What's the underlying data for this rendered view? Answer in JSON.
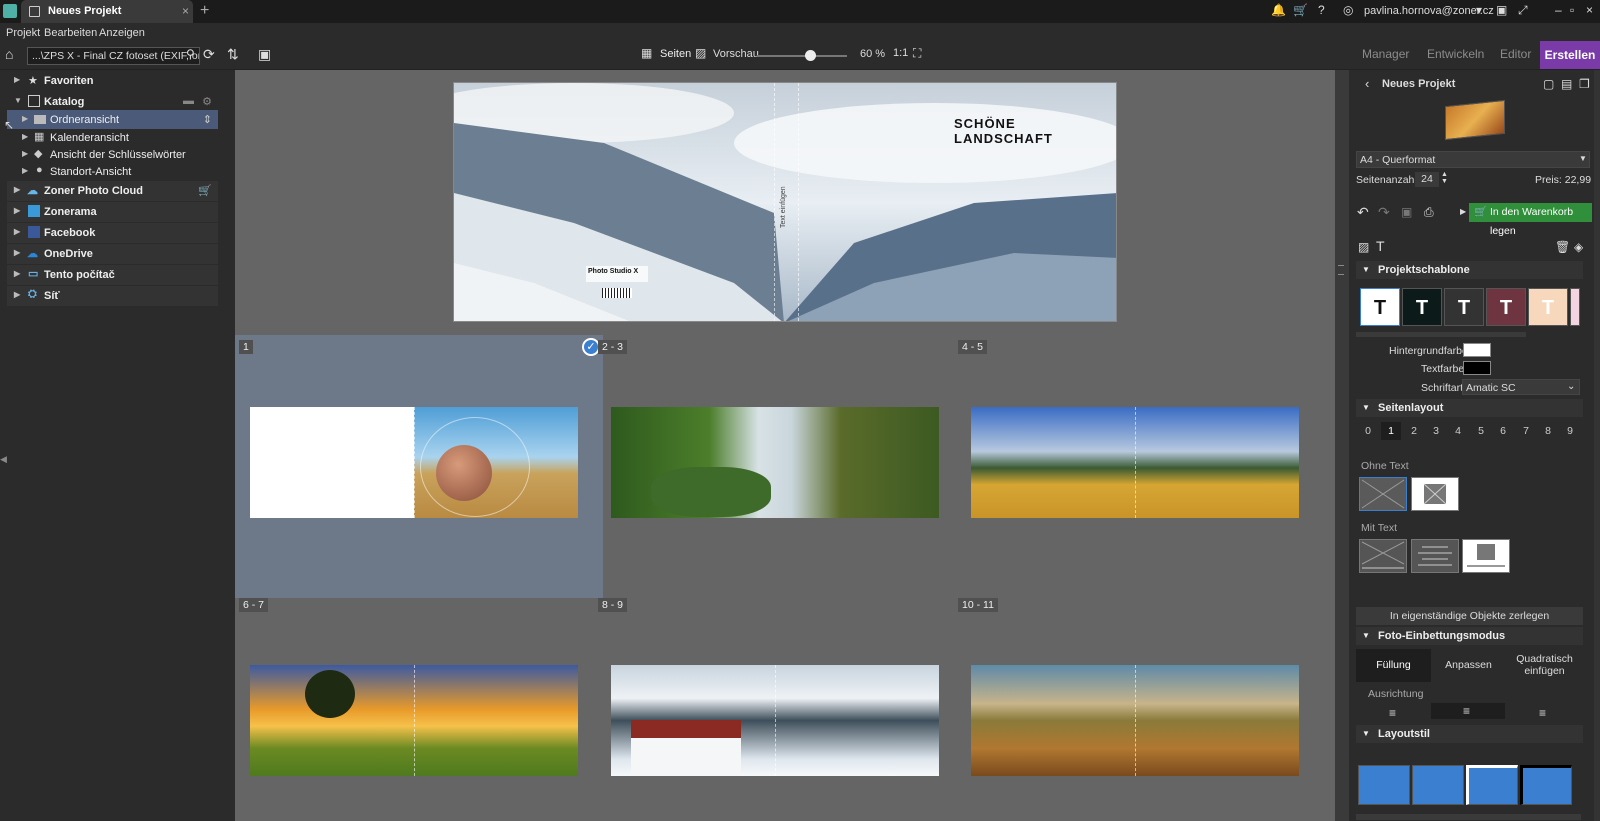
{
  "titlebar": {
    "tab_label": "Neues Projekt",
    "user": "pavlina.hornova@zoner.cz"
  },
  "menu": {
    "items": [
      "Projekt",
      "Bearbeiten",
      "Anzeigen"
    ]
  },
  "toolbar": {
    "path": "...\\ZPS X - Final CZ fotoset (EXIF, ordn",
    "view_pages": "Seiten",
    "view_preview": "Vorschau",
    "zoom": "60 %",
    "zoom_fraction": 0.55,
    "modes": [
      "Manager",
      "Entwickeln",
      "Editor",
      "Erstellen"
    ]
  },
  "navigator": {
    "favoriten": "Favoriten",
    "katalog": "Katalog",
    "ordneransicht": "Ordneransicht",
    "kalenderansicht": "Kalenderansicht",
    "schluessel": "Ansicht der Schlüsselwörter",
    "standort": "Standort-Ansicht",
    "cloud": "Zoner Photo Cloud",
    "zonerama": "Zonerama",
    "facebook": "Facebook",
    "onedrive": "OneDrive",
    "pc": "Tento počítač",
    "net": "Síť"
  },
  "cover": {
    "title": "SCHÖNE LANDSCHAFT",
    "spine": "Text einfügen",
    "logo_text": "Photo Studio X"
  },
  "pages": [
    "1",
    "2 - 3",
    "4 - 5",
    "6 - 7",
    "8 - 9",
    "10 - 11"
  ],
  "right": {
    "project_title": "Neues Projekt",
    "format": "A4 - Querformat",
    "pagecount_label": "Seitenanzahl:",
    "pagecount": "24",
    "price": "Preis: 22,99 €",
    "cart_button": "In den Warenkorb legen",
    "sec_template": "Projektschablone",
    "bg_color_label": "Hintergrundfarbe",
    "text_color_label": "Textfarbe",
    "font_label": "Schriftart",
    "font_value": "Amatic SC",
    "sec_layout": "Seitenlayout",
    "layout_numbers": [
      "0",
      "1",
      "2",
      "3",
      "4",
      "5",
      "6",
      "7",
      "8",
      "9"
    ],
    "ohne_text": "Ohne Text",
    "mit_text": "Mit Text",
    "split_button": "In eigenständige Objekte zerlegen",
    "sec_embed": "Foto-Einbettungsmodus",
    "embed_fill": "Füllung",
    "embed_fit": "Anpassen",
    "embed_square_1": "Quadratisch",
    "embed_square_2": "einfügen",
    "ausrichtung": "Ausrichtung",
    "sec_style": "Layoutstil",
    "template_letter": "T"
  },
  "colors": {
    "accent_purple": "#7a3aa8",
    "cart_green": "#2f8f3a",
    "selection": "#6d7888"
  }
}
